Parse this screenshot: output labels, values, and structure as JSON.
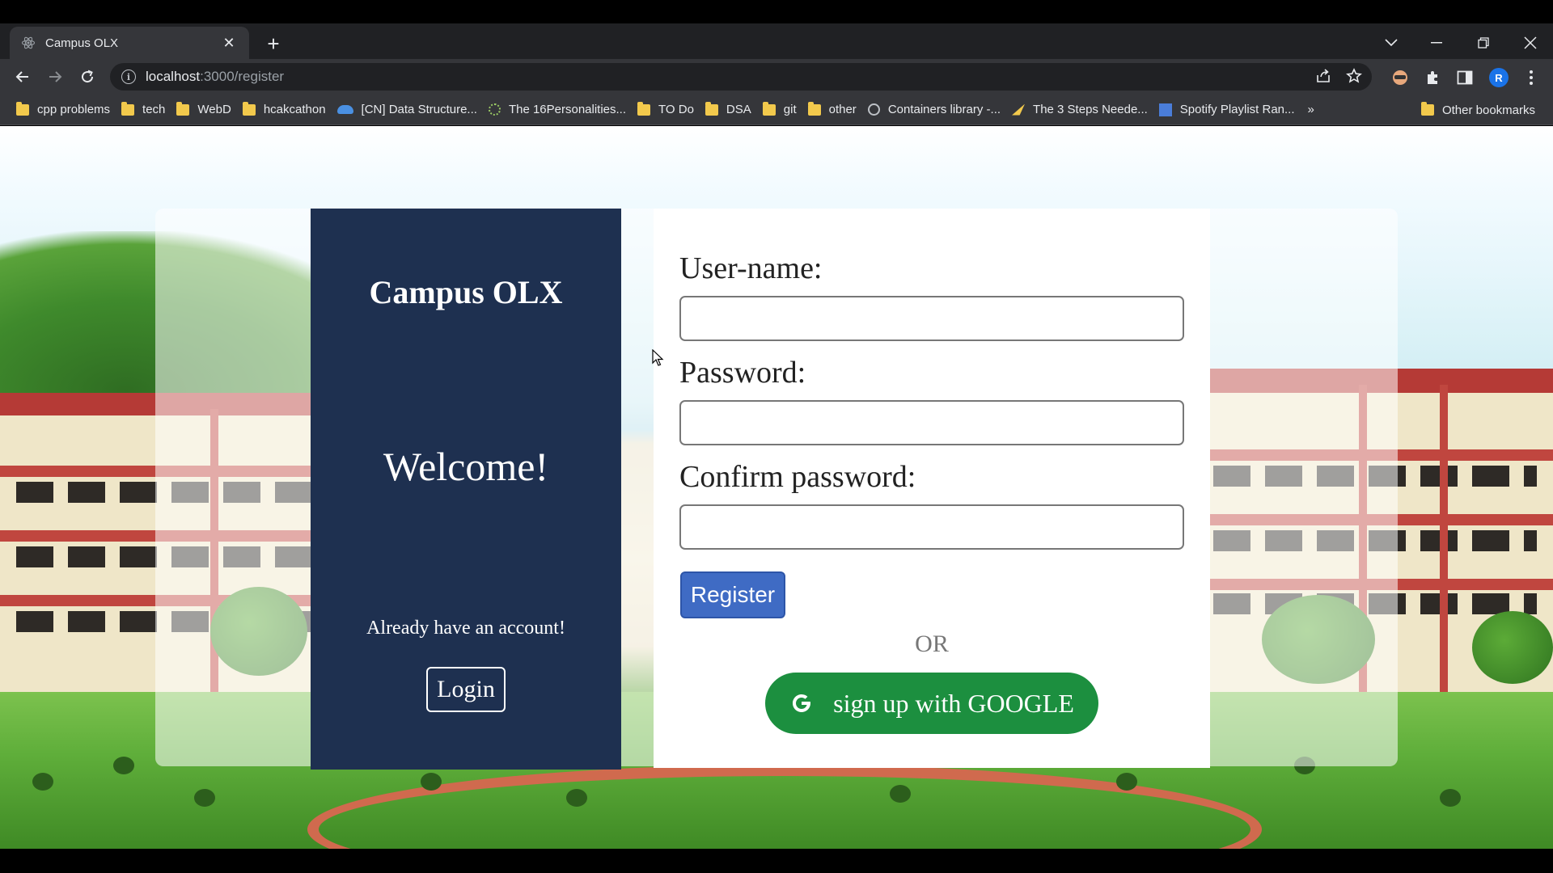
{
  "browser": {
    "tab_title": "Campus OLX",
    "url_host": "localhost",
    "url_path": ":3000/register",
    "profile_initial": "R",
    "bookmarks": [
      {
        "label": "cpp problems",
        "icon": "folder-icon"
      },
      {
        "label": "tech",
        "icon": "folder-icon"
      },
      {
        "label": "WebD",
        "icon": "folder-icon"
      },
      {
        "label": "hcakcathon",
        "icon": "folder-icon"
      },
      {
        "label": "[CN] Data Structure...",
        "icon": "cloud-icon"
      },
      {
        "label": "The 16Personalities...",
        "icon": "site-icon"
      },
      {
        "label": "TO Do",
        "icon": "folder-icon"
      },
      {
        "label": "DSA",
        "icon": "folder-icon"
      },
      {
        "label": "git",
        "icon": "folder-icon"
      },
      {
        "label": "other",
        "icon": "folder-icon"
      },
      {
        "label": "Containers library -...",
        "icon": "site-icon"
      },
      {
        "label": "The 3 Steps Neede...",
        "icon": "site-icon"
      },
      {
        "label": "Spotify Playlist Ran...",
        "icon": "site-icon"
      }
    ],
    "bookmarks_overflow": "»",
    "other_bookmarks": "Other bookmarks"
  },
  "page": {
    "brand": "Campus OLX",
    "welcome": "Welcome!",
    "have_account": "Already have an account!",
    "login_label": "Login",
    "fields": {
      "username_label": "User-name:",
      "username_value": "",
      "password_label": "Password:",
      "password_value": "",
      "confirm_label": "Confirm password:",
      "confirm_value": ""
    },
    "register_label": "Register",
    "or_text": "OR",
    "google_label": "sign up with GOOGLE"
  },
  "colors": {
    "left_panel": "#1e3050",
    "register_button": "#3f6bc4",
    "google_button": "#1c8f3f"
  }
}
